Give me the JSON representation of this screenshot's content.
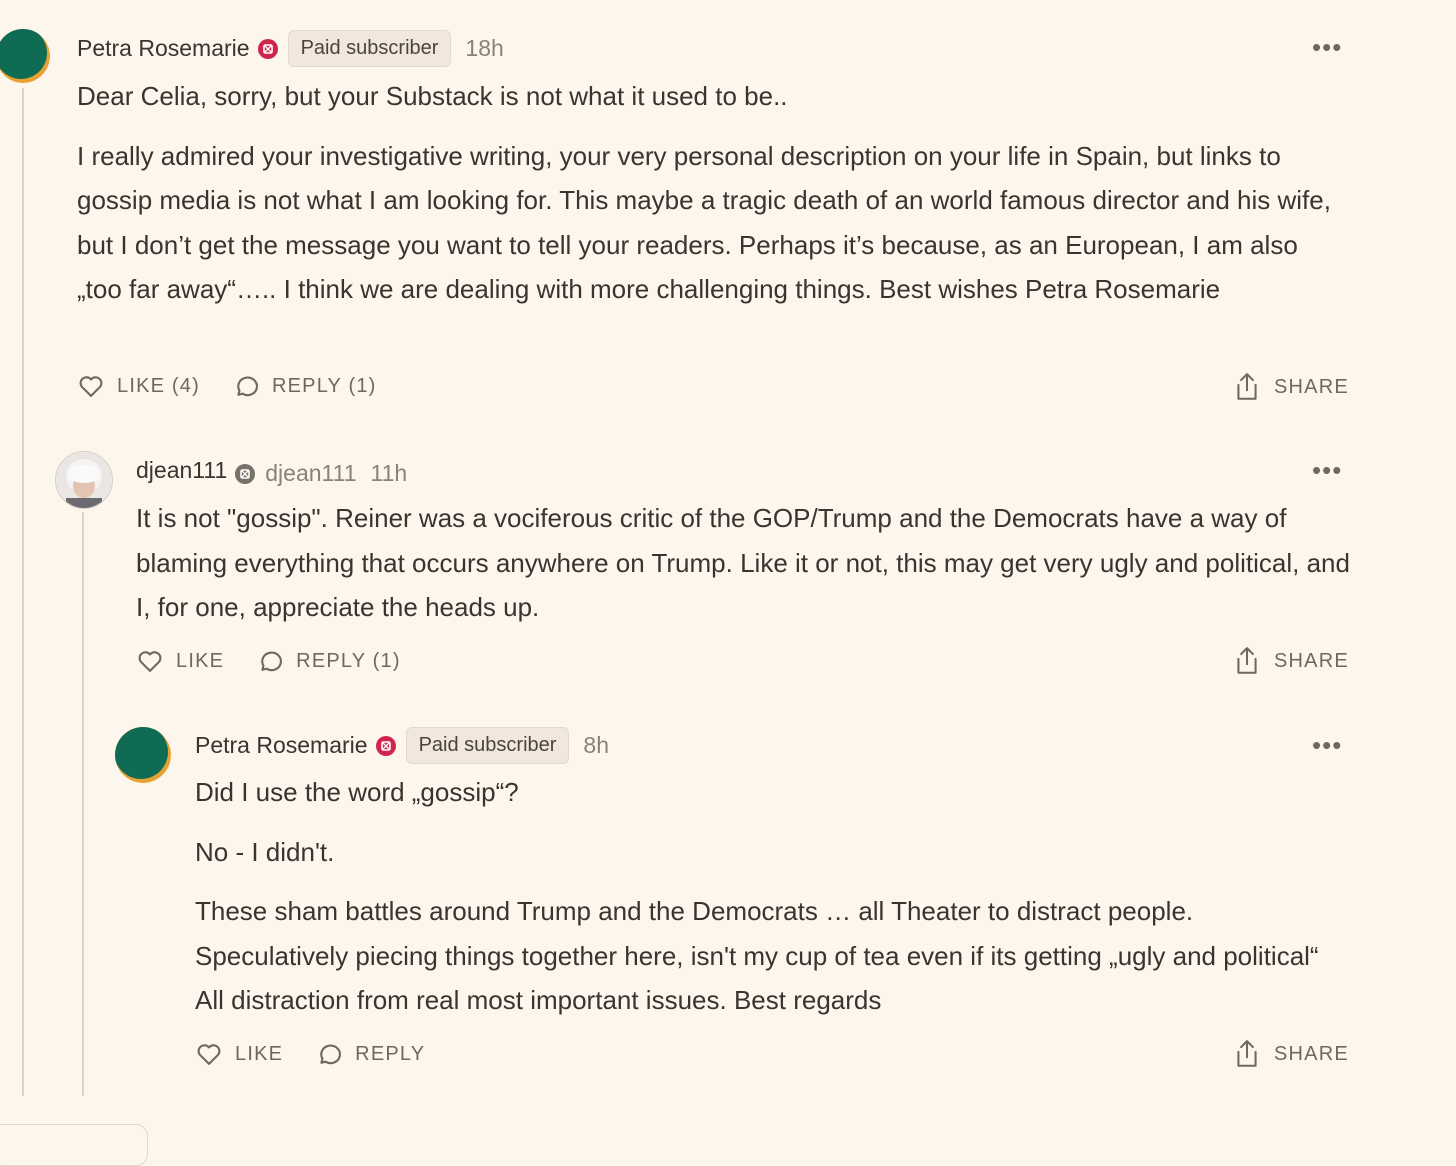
{
  "comments": [
    {
      "author": "Petra Rosemarie",
      "badge": "Paid subscriber",
      "time": "18h",
      "paragraphs": [
        "Dear Celia, sorry, but your Substack is not what it used to be..",
        "I really admired your investigative writing, your very personal description on your life in Spain, but links to gossip media is not what I am looking for. This maybe a tragic death of an world famous director and his wife, but I don’t get the message you want to tell your readers. Perhaps it’s because, as an European, I am also „too far away“….. I think we are dealing with more challenging things. Best wishes Petra Rosemarie"
      ],
      "like_label": "LIKE (4)",
      "reply_label": "REPLY (1)",
      "share_label": "SHARE"
    },
    {
      "author": "djean111",
      "handle": "djean111",
      "time": "11h",
      "paragraphs": [
        "It is not \"gossip\". Reiner was a vociferous critic of the GOP/Trump and the Democrats have a way of blaming everything that occurs anywhere on Trump. Like it or not, this may get very ugly and political, and I, for one, appreciate the heads up."
      ],
      "like_label": "LIKE",
      "reply_label": "REPLY (1)",
      "share_label": "SHARE"
    },
    {
      "author": "Petra Rosemarie",
      "badge": "Paid subscriber",
      "time": "8h",
      "paragraphs": [
        "Did I use the word „gossip“?",
        "No - I didn't.",
        "These sham battles around Trump and the Democrats … all Theater to distract people. Speculatively piecing things together here, isn't my cup of tea even if its getting „ugly and political“ All distraction from real most important issues. Best regards"
      ],
      "like_label": "LIKE",
      "reply_label": "REPLY",
      "share_label": "SHARE"
    }
  ],
  "icons": {
    "more": "more-dots-icon",
    "like": "heart-icon",
    "reply": "comment-bubble-icon",
    "share": "share-upload-icon",
    "badge": "subscriber-badge-icon"
  },
  "colors": {
    "background": "#fdf6ec",
    "badge_red": "#d0254a",
    "badge_grey": "#777069",
    "avatar_green": "#0f6b53",
    "avatar_orange": "#e8a234"
  },
  "ellipsis": "•••"
}
